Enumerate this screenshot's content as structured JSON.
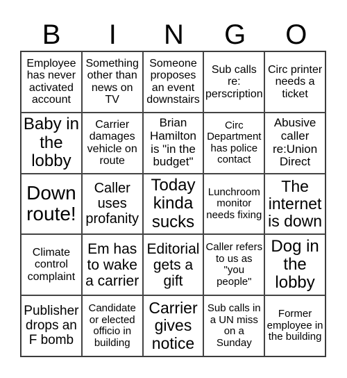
{
  "header": [
    "B",
    "I",
    "N",
    "G",
    "O"
  ],
  "cells": [
    "Employee has never activated account",
    "Something other than news on TV",
    "Someone proposes an event downstairs",
    "Sub calls re: perscription",
    "Circ printer needs a ticket",
    "Baby in the lobby",
    "Carrier damages vehicle on route",
    "Brian Hamilton is \"in the budget\"",
    "Circ Department has police contact",
    "Abusive caller re:Union Direct",
    "Down route!",
    "Caller uses profanity",
    "Today kinda sucks",
    "Lunchroom monitor needs fixing",
    "The internet is down",
    "Climate control complaint",
    "Em has to wake a carrier",
    "Editorial gets a gift",
    "Caller refers to us as \"you people\"",
    "Dog in the lobby",
    "Publisher drops an F bomb",
    "Candidate or elected officio in building",
    "Carrier gives notice",
    "Sub calls in a UN miss on a Sunday",
    "Former employee in the building"
  ]
}
